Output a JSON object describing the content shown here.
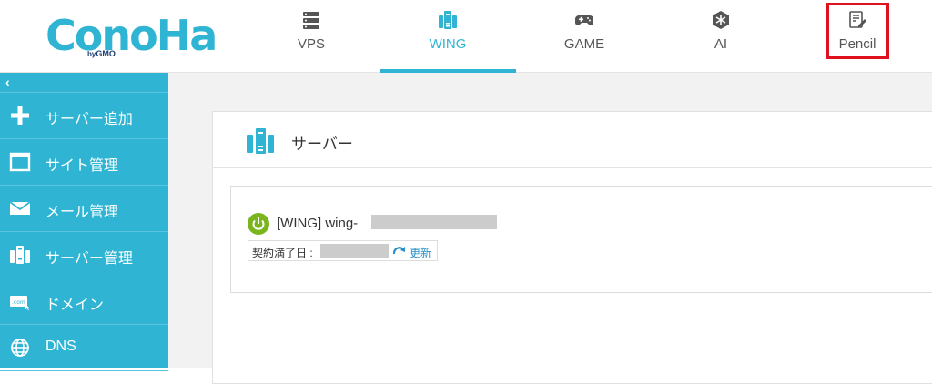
{
  "logo": {
    "text": "ConoHa",
    "sub_prefix": "by",
    "sub_brand": "GMO"
  },
  "nav": {
    "items": [
      {
        "label": "VPS",
        "icon": "server-rack-icon"
      },
      {
        "label": "WING",
        "icon": "wing-server-icon",
        "active": true
      },
      {
        "label": "GAME",
        "icon": "gamepad-icon"
      },
      {
        "label": "AI",
        "icon": "ai-chip-icon"
      },
      {
        "label": "Pencil",
        "icon": "pencil-document-icon",
        "highlighted": true
      }
    ]
  },
  "sidebar": {
    "collapse_symbol": "‹",
    "items": [
      {
        "label": "サーバー追加",
        "icon": "plus-icon"
      },
      {
        "label": "サイト管理",
        "icon": "window-icon"
      },
      {
        "label": "メール管理",
        "icon": "mail-icon"
      },
      {
        "label": "サーバー管理",
        "icon": "server-icon"
      },
      {
        "label": "ドメイン",
        "icon": "domain-com-icon"
      },
      {
        "label": "DNS",
        "icon": "globe-icon"
      }
    ]
  },
  "main": {
    "section_title": "サーバー",
    "server": {
      "name_prefix": "[WING] wing-",
      "status_icon": "power-on-icon",
      "contract_label": "契約満了日 :",
      "renew_link": "更新"
    }
  },
  "colors": {
    "brand": "#2fb5d3",
    "highlight": "#e0101f",
    "power": "#7ab51d",
    "link": "#2a8fc5"
  }
}
